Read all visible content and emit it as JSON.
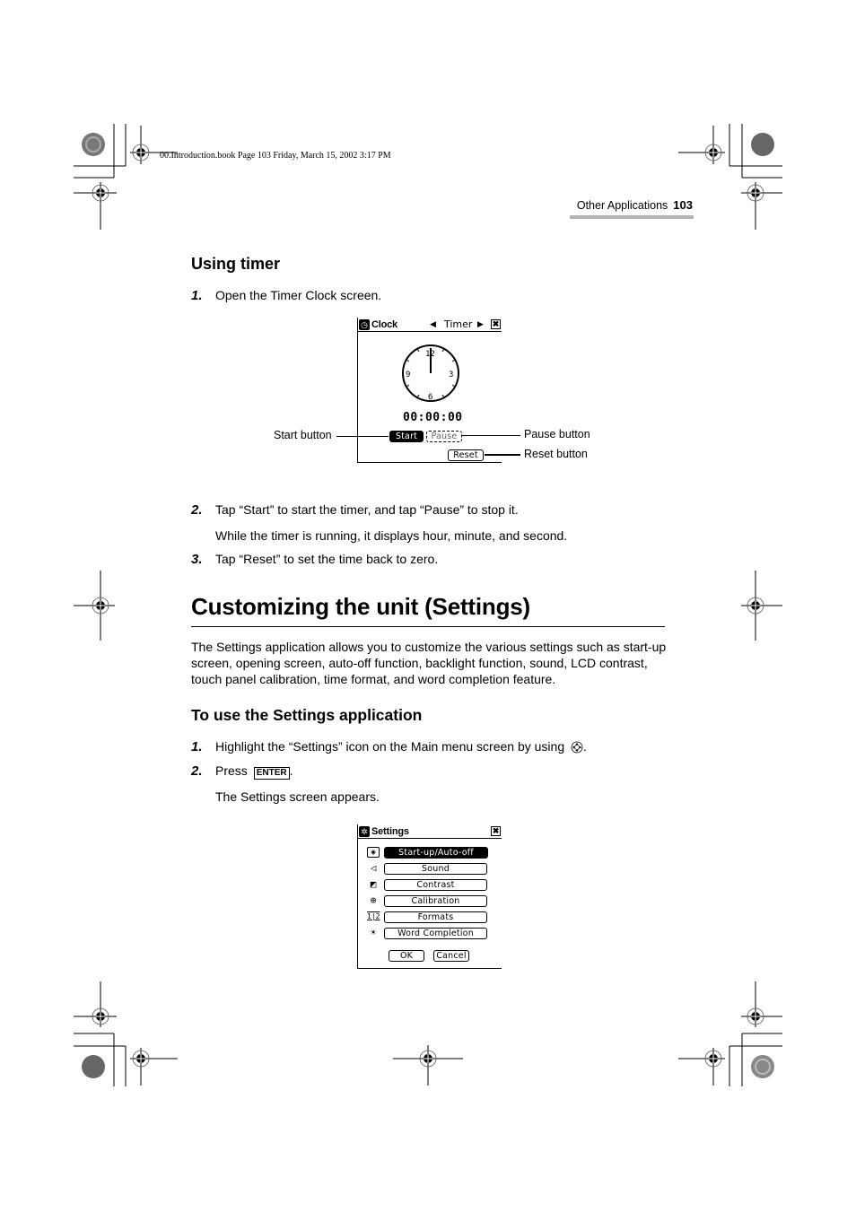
{
  "slug": "00.Introduction.book  Page 103  Friday, March 15, 2002  3:17 PM",
  "running_head": {
    "section": "Other Applications",
    "page": "103"
  },
  "timer_section": {
    "heading": "Using timer",
    "step1": {
      "num": "1.",
      "text": "Open the Timer Clock screen."
    },
    "screen": {
      "title": "Clock",
      "mode": "Timer",
      "prev_icon": "◀",
      "next_icon": "▶",
      "close_icon": "✖",
      "dial": {
        "n12": "12",
        "n3": "3",
        "n6": "6",
        "n9": "9"
      },
      "time": "00:00:00",
      "start_label": "Start",
      "pause_label": "Pause",
      "reset_label": "Reset"
    },
    "callouts": {
      "start": "Start button",
      "pause": "Pause button",
      "reset": "Reset button"
    },
    "step2": {
      "num": "2.",
      "text": "Tap “Start” to start the timer, and tap “Pause” to stop it."
    },
    "step2_note": "While the timer is running, it displays hour, minute, and second.",
    "step3": {
      "num": "3.",
      "text": "Tap “Reset” to set the time back to zero."
    }
  },
  "settings_section": {
    "heading": "Customizing the unit (Settings)",
    "intro": "The Settings application allows you to customize the various settings such as start-up screen, opening screen, auto-off function, backlight function, sound, LCD contrast, touch panel calibration, time format, and word completion feature.",
    "subheading": "To use the Settings application",
    "step1": {
      "num": "1.",
      "text": "Highlight the “Settings” icon on the Main menu screen by using",
      "end": "."
    },
    "step2": {
      "num": "2.",
      "text": "Press",
      "key": "ENTER",
      "end": "."
    },
    "step2_note": "The Settings screen appears.",
    "screen": {
      "title": "Settings",
      "close_icon": "✖",
      "items": [
        {
          "label": "Start-up/Auto-off",
          "icon": "startup-icon",
          "glyph": "◉",
          "selected": true
        },
        {
          "label": "Sound",
          "icon": "speaker-icon",
          "glyph": "◁",
          "selected": false
        },
        {
          "label": "Contrast",
          "icon": "contrast-icon",
          "glyph": "◩",
          "selected": false
        },
        {
          "label": "Calibration",
          "icon": "crosshair-icon",
          "glyph": "⊕",
          "selected": false
        },
        {
          "label": "Formats",
          "icon": "formats-icon",
          "glyph": "1|2",
          "selected": false
        },
        {
          "label": "Word Completion",
          "icon": "lightbulb-icon",
          "glyph": "☀",
          "selected": false
        }
      ],
      "ok_label": "OK",
      "cancel_label": "Cancel"
    }
  }
}
